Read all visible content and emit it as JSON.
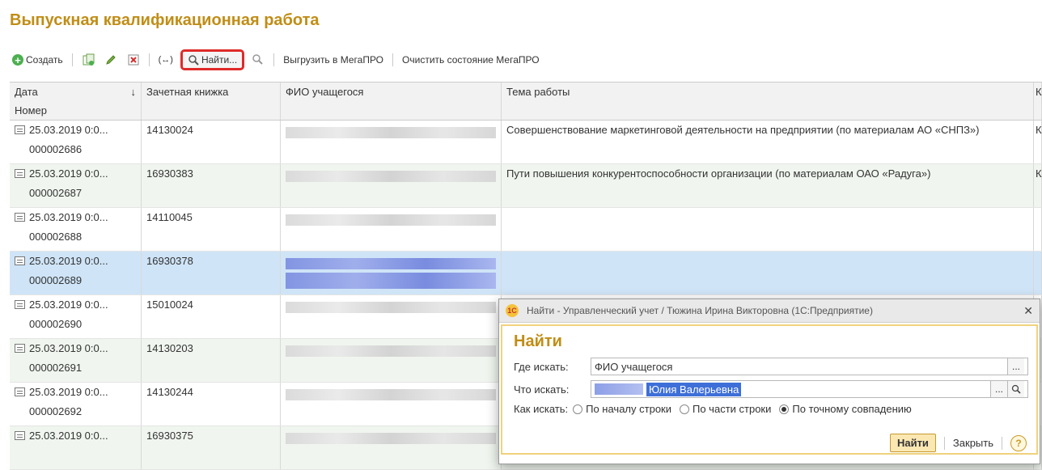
{
  "form": {
    "title": "Выпускная квалификационная работа"
  },
  "toolbar": {
    "create_label": "Создать",
    "find_label": "Найти...",
    "export_label": "Выгрузить в МегаПРО",
    "clear_label": "Очистить состояние МегаПРО"
  },
  "grid": {
    "headers": {
      "date": "Дата",
      "number": "Номер",
      "record_book": "Зачетная книжка",
      "student": "ФИО учащегося",
      "topic": "Тема работы",
      "extra": "К"
    },
    "sort_indicator": "↓",
    "rows": [
      {
        "date": "25.03.2019 0:0...",
        "number": "000002686",
        "record_book": "14130024",
        "topic": "Совершенствование маркетинговой деятельности на предприятии (по материалам АО «СНПЗ»)",
        "extra": "К"
      },
      {
        "date": "25.03.2019 0:0...",
        "number": "000002687",
        "record_book": "16930383",
        "topic": "Пути повышения конкурентоспособности организации (по материалам ОАО «Радуга»)",
        "extra": "К"
      },
      {
        "date": "25.03.2019 0:0...",
        "number": "000002688",
        "record_book": "14110045",
        "topic": "",
        "extra": ""
      },
      {
        "date": "25.03.2019 0:0...",
        "number": "000002689",
        "record_book": "16930378",
        "topic": "",
        "extra": ""
      },
      {
        "date": "25.03.2019 0:0...",
        "number": "000002690",
        "record_book": "15010024",
        "topic": "",
        "extra": ""
      },
      {
        "date": "25.03.2019 0:0...",
        "number": "000002691",
        "record_book": "14130203",
        "topic": "",
        "extra": ""
      },
      {
        "date": "25.03.2019 0:0...",
        "number": "000002692",
        "record_book": "14130244",
        "topic": "",
        "extra": ""
      },
      {
        "date": "25.03.2019 0:0...",
        "number": "",
        "record_book": "16930375",
        "topic": "",
        "extra": ""
      }
    ]
  },
  "dialog": {
    "window_title": "Найти - Управленческий учет / Тюжина Ирина Викторовна (1С:Предприятие)",
    "heading": "Найти",
    "where_label": "Где искать:",
    "where_value": "ФИО учащегося",
    "what_label": "Что искать:",
    "what_value": "Юлия Валерьевна",
    "how_label": "Как искать:",
    "option_start": "По началу строки",
    "option_part": "По части строки",
    "option_exact": "По точному совпадению",
    "find_button": "Найти",
    "close_button": "Закрыть",
    "help": "?"
  }
}
